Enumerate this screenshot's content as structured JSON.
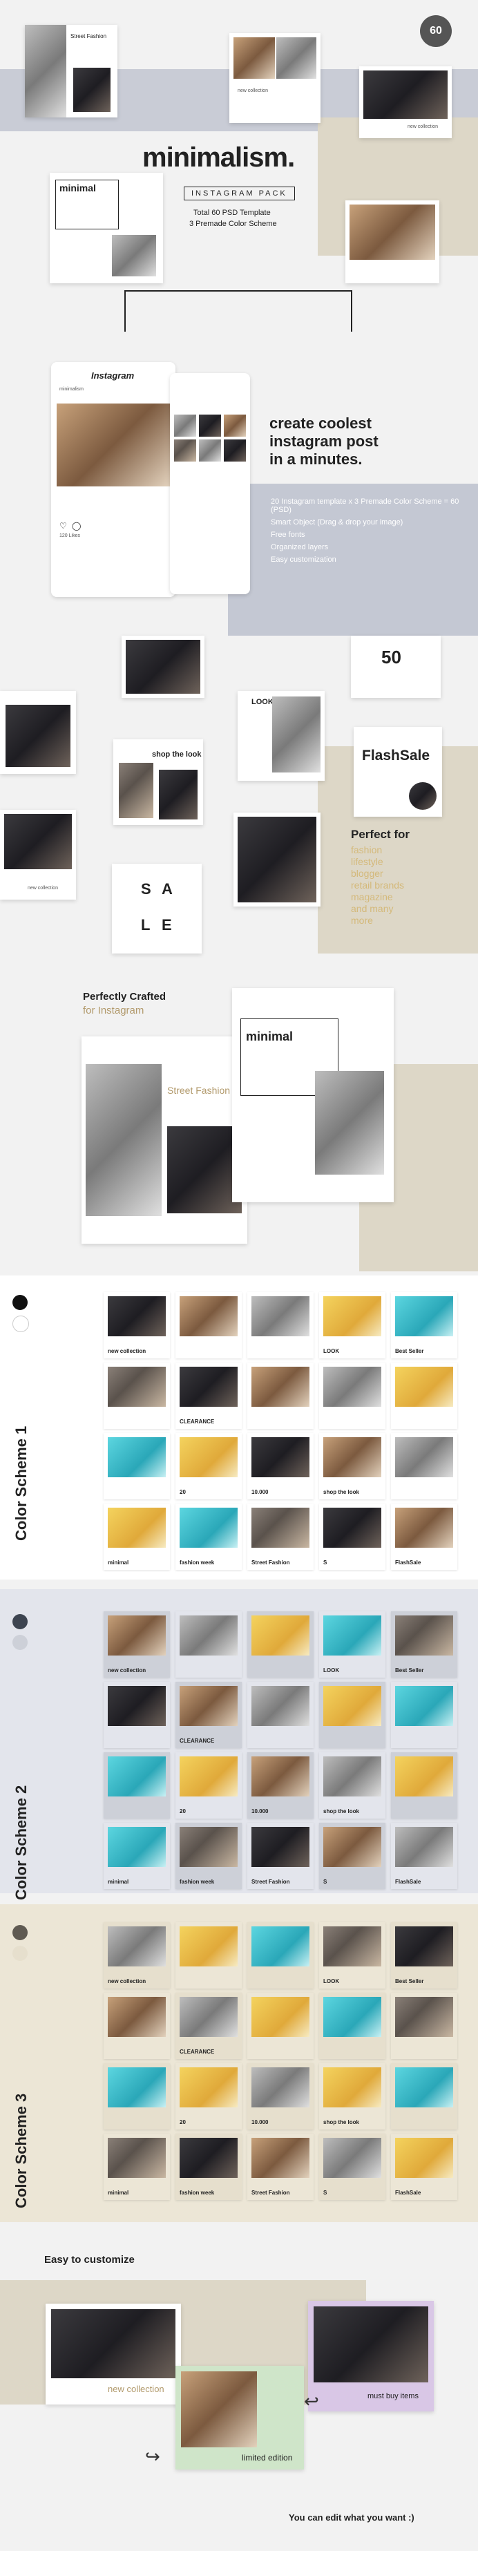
{
  "badge": {
    "count": "60"
  },
  "hero": {
    "title": "minimalism.",
    "tag": "INSTAGRAM PACK",
    "sub1": "Total 60 PSD Template",
    "sub2": "3 Premade Color Scheme"
  },
  "card_texts": {
    "street_fashion": "Street Fashion",
    "new_collection": "new collection",
    "minimal": "minimal",
    "shop_the_look": "shop the look",
    "flash_sale": "FlashSale",
    "look": "LOOK",
    "best_seller": "Best Seller",
    "fashion_week": "fashion week",
    "clearance": "CLEARANCE",
    "fifty": "50",
    "twenty": "20",
    "ten_k": "10.000",
    "sale_s": "S",
    "sale_a": "A",
    "sale_l": "L",
    "sale_e": "E",
    "limited_edition": "limited edition",
    "must_buy": "must buy items"
  },
  "promo": {
    "line1": "create coolest",
    "line2": "instagram post",
    "line3": "in a minutes.",
    "features": [
      "20 Instagram template x 3 Premade Color Scheme = 60 (PSD)",
      "Smart Object (Drag & drop your image)",
      "Free fonts",
      "Organized layers",
      "Easy customization"
    ]
  },
  "perfect_for": {
    "title": "Perfect for",
    "items": [
      "fashion",
      "lifestyle",
      "blogger",
      "retail brands",
      "magazine",
      "and many",
      "more"
    ]
  },
  "crafted": {
    "line1": "Perfectly Crafted",
    "line2": "for Instagram"
  },
  "phone": {
    "app_name": "Instagram",
    "username": "minimalism",
    "likes": "120 Likes"
  },
  "schemes": [
    {
      "label": "Color Scheme 1",
      "dot1": "#111111",
      "dot2": "#ffffff",
      "bg": "#ffffff"
    },
    {
      "label": "Color Scheme 2",
      "dot1": "#3d4450",
      "dot2": "#cdd0d8",
      "bg": "#e3e5ec"
    },
    {
      "label": "Color Scheme 3",
      "dot1": "#5f5a52",
      "dot2": "#e6dfcd",
      "bg": "#ece6d6"
    }
  ],
  "customize": {
    "title": "Easy to customize",
    "footer": "You can edit what you want :)"
  },
  "colors": {
    "navy_band": "#c9ccd6",
    "beige_band": "#ddd7c7",
    "promo_panel": "#c4c8d3",
    "accent_pink": "#e8b8c0",
    "accent_lilac": "#d9c7e6",
    "accent_mint": "#cfe5c9"
  }
}
